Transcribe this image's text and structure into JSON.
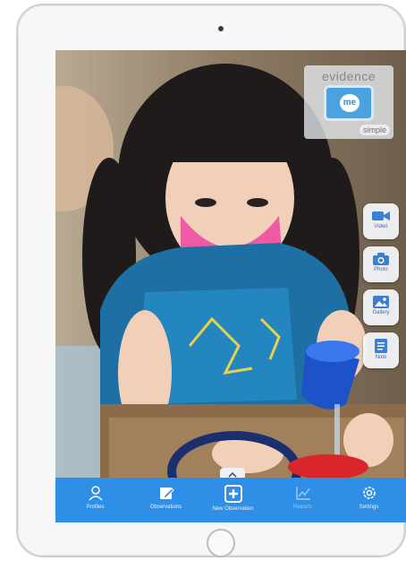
{
  "app": {
    "logo_word": "evidence",
    "logo_badge": "me",
    "logo_simple": "simple"
  },
  "side_actions": [
    {
      "label": "Video",
      "icon": "video-icon"
    },
    {
      "label": "Photo",
      "icon": "camera-icon"
    },
    {
      "label": "Gallery",
      "icon": "gallery-icon"
    },
    {
      "label": "Note",
      "icon": "note-icon"
    }
  ],
  "tabbar": {
    "items": [
      {
        "label": "Profiles",
        "icon": "person-icon"
      },
      {
        "label": "Observations",
        "icon": "edit-icon"
      },
      {
        "label": "New Observation",
        "icon": "plus-square-icon"
      },
      {
        "label": "Reports",
        "icon": "chart-icon"
      },
      {
        "label": "Settings",
        "icon": "gear-icon"
      }
    ],
    "handle_icon": "chevron-up-icon"
  },
  "colors": {
    "accent": "#2f8fe6",
    "side_button_bg": "#f5f8fc"
  }
}
